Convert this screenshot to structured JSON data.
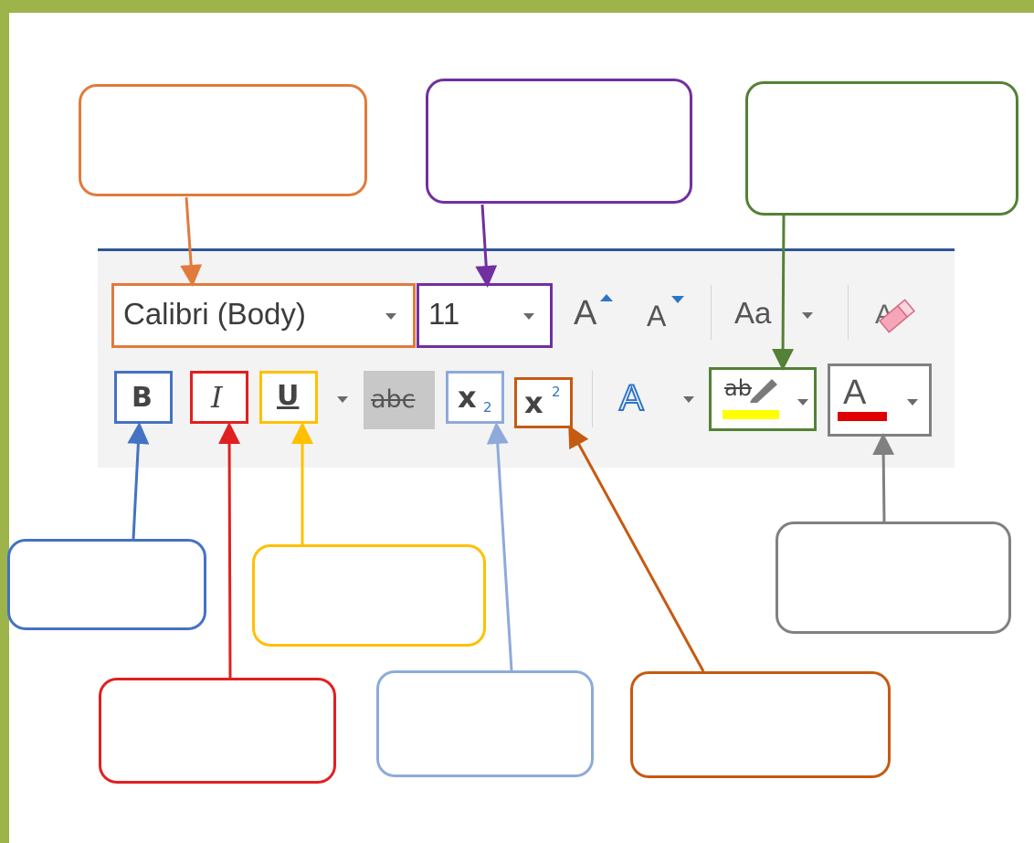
{
  "ribbon": {
    "font_name": {
      "value": "Calibri (Body)"
    },
    "font_size": {
      "value": "11"
    },
    "buttons": {
      "grow_font": "A",
      "shrink_font": "A",
      "change_case": "Aa",
      "bold": "B",
      "italic": "I",
      "underline": "U",
      "strikethrough": "abc",
      "subscript": "x",
      "subscript_small": "2",
      "superscript": "x",
      "superscript_small": "2",
      "text_effects": "A",
      "highlight": "ab",
      "font_color": "A"
    },
    "colors": {
      "accent_border": "#2f5597",
      "highlight_bar": "#ffff00",
      "font_color_bar": "#e00000"
    }
  },
  "callouts": [
    {
      "id": "font-name-callout",
      "color": "#e07b3c",
      "text": ""
    },
    {
      "id": "font-size-callout",
      "color": "#7030a0",
      "text": ""
    },
    {
      "id": "highlight-callout",
      "color": "#538135",
      "text": ""
    },
    {
      "id": "bold-callout",
      "color": "#4472c4",
      "text": ""
    },
    {
      "id": "underline-callout",
      "color": "#ffc000",
      "text": ""
    },
    {
      "id": "font-color-callout",
      "color": "#808080",
      "text": ""
    },
    {
      "id": "italic-callout",
      "color": "#e02020",
      "text": ""
    },
    {
      "id": "subscript-callout",
      "color": "#8eaadb",
      "text": ""
    },
    {
      "id": "superscript-callout",
      "color": "#c55a11",
      "text": ""
    }
  ]
}
